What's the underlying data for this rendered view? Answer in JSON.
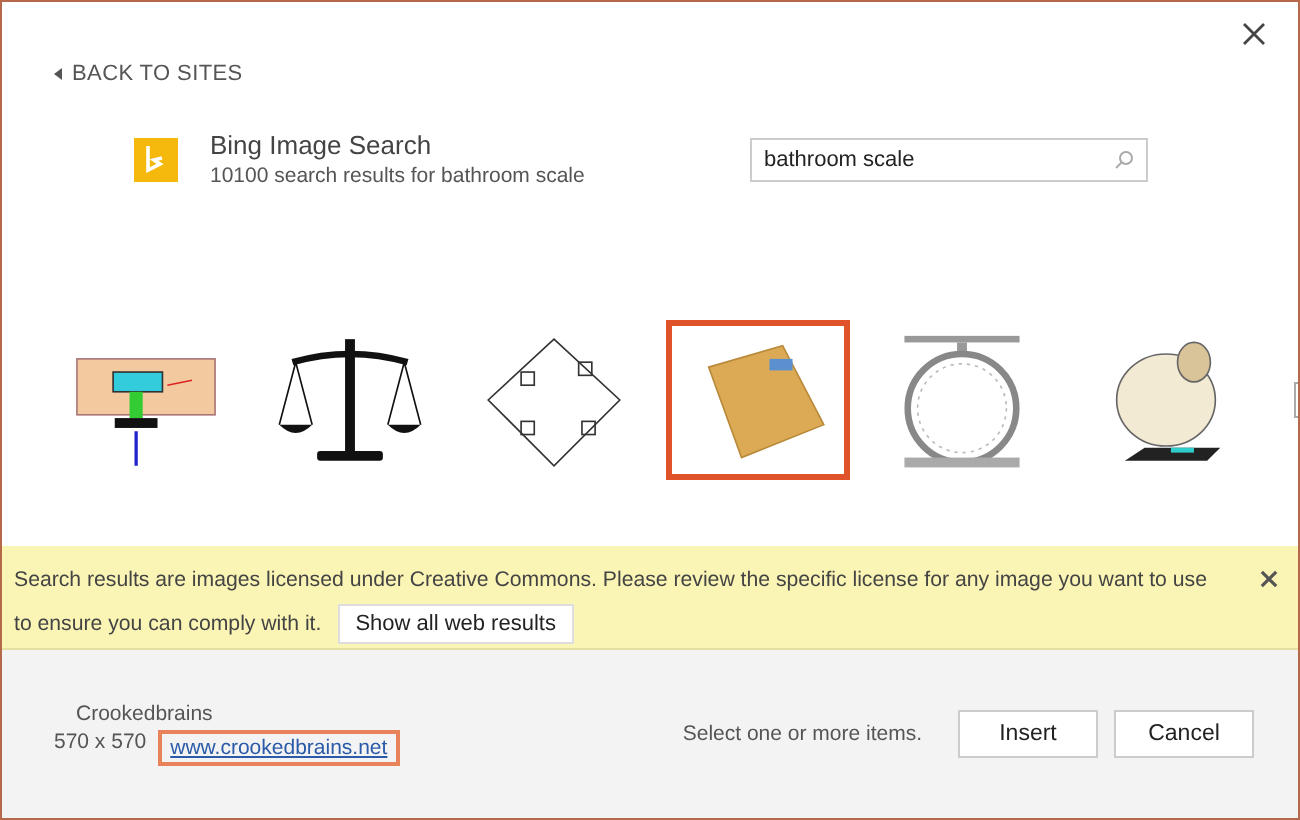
{
  "back_link": {
    "label": "BACK TO SITES"
  },
  "source": {
    "title": "Bing Image Search",
    "subtitle": "10100 search results for bathroom scale"
  },
  "search": {
    "value": "bathroom scale"
  },
  "thumbnails": [
    {
      "kind": "diagram",
      "selected": false
    },
    {
      "kind": "balance",
      "selected": false
    },
    {
      "kind": "circuit",
      "selected": false
    },
    {
      "kind": "bathroom-scale",
      "selected": true
    },
    {
      "kind": "kitchen-scale",
      "selected": false
    },
    {
      "kind": "sheep",
      "selected": false
    }
  ],
  "notice": {
    "lines": [
      "Search results are images licensed under Creative Commons. Please review the specific license for any image you want to use",
      "to ensure you can comply with it."
    ],
    "button": "Show all web results"
  },
  "details": {
    "author": "Crookedbrains",
    "size": "570 x 570",
    "link": "www.crookedbrains.net"
  },
  "footer": {
    "hint": "Select one or more items.",
    "buttons": [
      "Insert",
      "Cancel"
    ]
  }
}
